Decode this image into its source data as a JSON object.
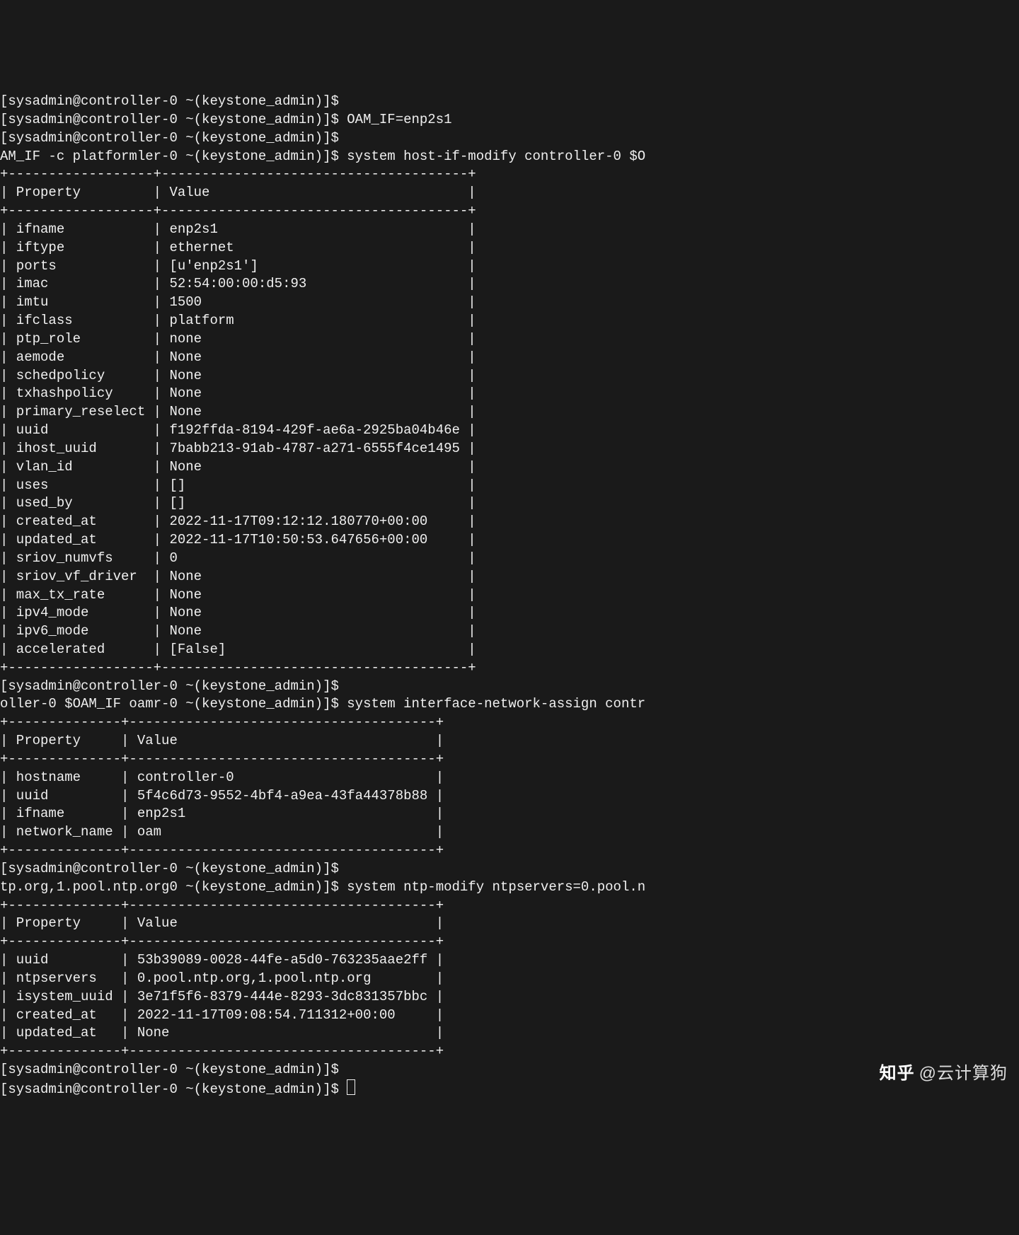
{
  "prompts": {
    "p1": "[sysadmin@controller-0 ~(keystone_admin)]$",
    "p2": "[sysadmin@controller-0 ~(keystone_admin)]$ OAM_IF=enp2s1",
    "p3": "[sysadmin@controller-0 ~(keystone_admin)]$",
    "p4": "AM_IF -c platformler-0 ~(keystone_admin)]$ system host-if-modify controller-0 $O",
    "p5": "[sysadmin@controller-0 ~(keystone_admin)]$",
    "p6": "oller-0 $OAM_IF oamr-0 ~(keystone_admin)]$ system interface-network-assign contr",
    "p7": "[sysadmin@controller-0 ~(keystone_admin)]$",
    "p8": "tp.org,1.pool.ntp.org0 ~(keystone_admin)]$ system ntp-modify ntpservers=0.pool.n",
    "p9": "[sysadmin@controller-0 ~(keystone_admin)]$",
    "p10": "[sysadmin@controller-0 ~(keystone_admin)]$ "
  },
  "table1": {
    "hdr_prop": "Property",
    "hdr_val": "Value",
    "rows": [
      {
        "p": "ifname",
        "v": "enp2s1"
      },
      {
        "p": "iftype",
        "v": "ethernet"
      },
      {
        "p": "ports",
        "v": "[u'enp2s1']"
      },
      {
        "p": "imac",
        "v": "52:54:00:00:d5:93"
      },
      {
        "p": "imtu",
        "v": "1500"
      },
      {
        "p": "ifclass",
        "v": "platform"
      },
      {
        "p": "ptp_role",
        "v": "none"
      },
      {
        "p": "aemode",
        "v": "None"
      },
      {
        "p": "schedpolicy",
        "v": "None"
      },
      {
        "p": "txhashpolicy",
        "v": "None"
      },
      {
        "p": "primary_reselect",
        "v": "None"
      },
      {
        "p": "uuid",
        "v": "f192ffda-8194-429f-ae6a-2925ba04b46e"
      },
      {
        "p": "ihost_uuid",
        "v": "7babb213-91ab-4787-a271-6555f4ce1495"
      },
      {
        "p": "vlan_id",
        "v": "None"
      },
      {
        "p": "uses",
        "v": "[]"
      },
      {
        "p": "used_by",
        "v": "[]"
      },
      {
        "p": "created_at",
        "v": "2022-11-17T09:12:12.180770+00:00"
      },
      {
        "p": "updated_at",
        "v": "2022-11-17T10:50:53.647656+00:00"
      },
      {
        "p": "sriov_numvfs",
        "v": "0"
      },
      {
        "p": "sriov_vf_driver",
        "v": "None"
      },
      {
        "p": "max_tx_rate",
        "v": "None"
      },
      {
        "p": "ipv4_mode",
        "v": "None"
      },
      {
        "p": "ipv6_mode",
        "v": "None"
      },
      {
        "p": "accelerated",
        "v": "[False]"
      }
    ],
    "col1w": 18,
    "col2w": 38
  },
  "table2": {
    "hdr_prop": "Property",
    "hdr_val": "Value",
    "rows": [
      {
        "p": "hostname",
        "v": "controller-0"
      },
      {
        "p": "uuid",
        "v": "5f4c6d73-9552-4bf4-a9ea-43fa44378b88"
      },
      {
        "p": "ifname",
        "v": "enp2s1"
      },
      {
        "p": "network_name",
        "v": "oam"
      }
    ],
    "col1w": 14,
    "col2w": 38
  },
  "table3": {
    "hdr_prop": "Property",
    "hdr_val": "Value",
    "rows": [
      {
        "p": "uuid",
        "v": "53b39089-0028-44fe-a5d0-763235aae2ff"
      },
      {
        "p": "ntpservers",
        "v": "0.pool.ntp.org,1.pool.ntp.org"
      },
      {
        "p": "isystem_uuid",
        "v": "3e71f5f6-8379-444e-8293-3dc831357bbc"
      },
      {
        "p": "created_at",
        "v": "2022-11-17T09:08:54.711312+00:00"
      },
      {
        "p": "updated_at",
        "v": "None"
      }
    ],
    "col1w": 14,
    "col2w": 38
  },
  "watermark": {
    "brand": "知乎",
    "handle": "@云计算狗"
  }
}
